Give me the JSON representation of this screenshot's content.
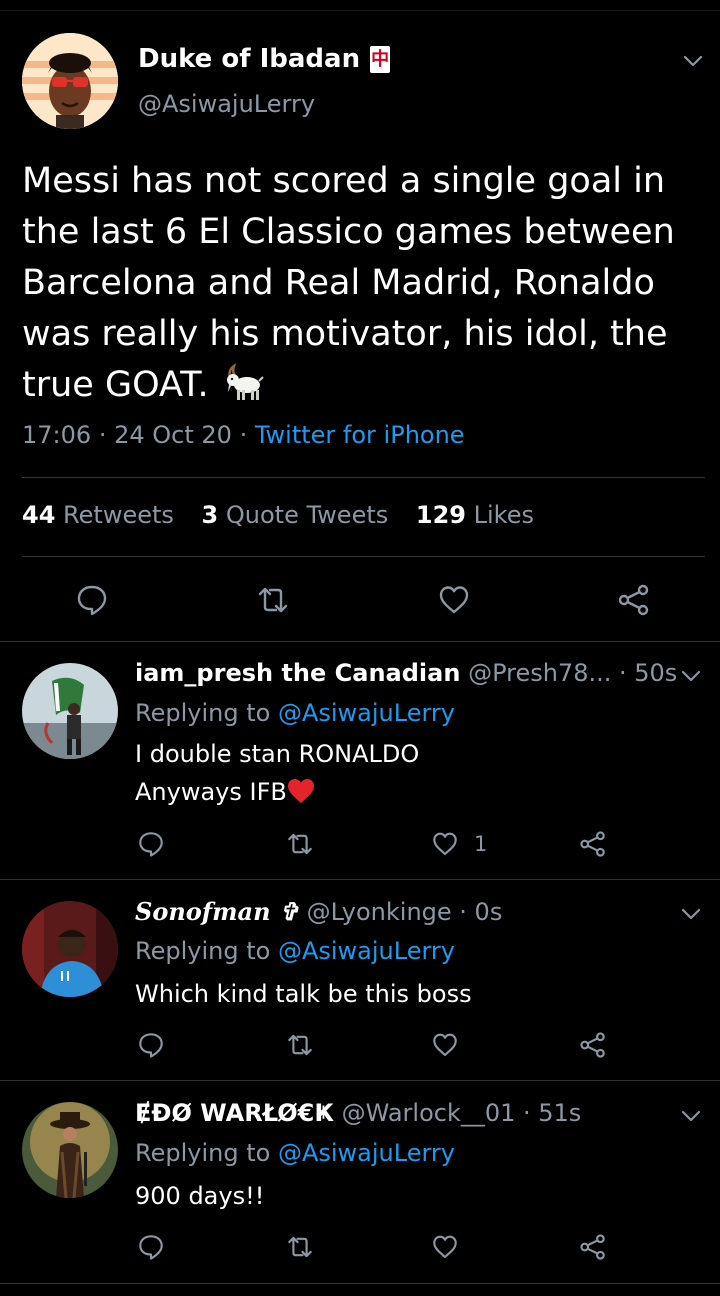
{
  "main_tweet": {
    "author_name": "Duke of Ibadan",
    "name_emoji": "中",
    "handle": "@AsiwajuLerry",
    "text": "Messi has not scored a single goal in the last 6 El Classico games between Barcelona and Real Madrid, Ronaldo was really his motivator, his idol, the true GOAT.",
    "text_emoji": "goat",
    "time": "17:06",
    "date": "24 Oct 20",
    "separator": "·",
    "source": "Twitter for iPhone",
    "stats": {
      "retweets_count": "44",
      "retweets_label": "Retweets",
      "quotes_count": "3",
      "quotes_label": "Quote Tweets",
      "likes_count": "129",
      "likes_label": "Likes"
    }
  },
  "replies": [
    {
      "name": "iam_presh the Canadian",
      "handle": "@Presh78...",
      "time": "· 50s",
      "replying_label": "Replying to",
      "replying_to": "@AsiwajuLerry",
      "line1": "I double stan RONALDO",
      "line2": "Anyways IFB",
      "line2_emoji": "red-heart",
      "like_count": "1"
    },
    {
      "name": "Sonofman ✞",
      "handle": "@Lyonkinge · 0s",
      "replying_label": "Replying to",
      "replying_to": "@AsiwajuLerry",
      "line1": "Which kind talk be this boss"
    },
    {
      "name": "ɆĐØ WARŁØ€Ҝ",
      "handle": "@Warlock__01 · 51s",
      "replying_label": "Replying to",
      "replying_to": "@AsiwajuLerry",
      "line1": "900 days!!"
    }
  ],
  "colors": {
    "background": "#000000",
    "secondary_text": "#8b98a5",
    "link": "#1d9bf0",
    "divider": "#2f3336"
  },
  "icons": [
    "reply-icon",
    "retweet-icon",
    "like-icon",
    "share-icon",
    "chevron-down-icon"
  ]
}
